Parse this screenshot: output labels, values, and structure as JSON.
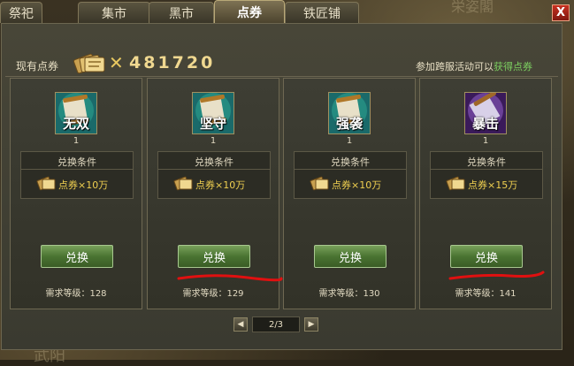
{
  "tabs": [
    {
      "label": "祭祀"
    },
    {
      "label": "集市"
    },
    {
      "label": "黑市"
    },
    {
      "label": "点券"
    },
    {
      "label": "铁匠铺"
    }
  ],
  "active_tab": "点券",
  "close_label": "X",
  "background_text": {
    "top_right": "栄姿閣",
    "bottom_left": "武阳"
  },
  "header": {
    "label": "现有点券",
    "multiplier": "✕",
    "points": "481720",
    "hint_prefix": "参加跨服活动可以",
    "hint_link": "获得点券"
  },
  "cards": [
    {
      "icon_text": "无双",
      "icon_style": "scroll-teal",
      "qty": "1",
      "cond_title": "兑换条件",
      "cond_value": "点券×10万",
      "button": "兑换",
      "requirement": "需求等级：128"
    },
    {
      "icon_text": "坚守",
      "icon_style": "scroll-teal",
      "qty": "1",
      "cond_title": "兑换条件",
      "cond_value": "点券×10万",
      "button": "兑换",
      "requirement": "需求等级：129"
    },
    {
      "icon_text": "强袭",
      "icon_style": "scroll-teal",
      "qty": "1",
      "cond_title": "兑换条件",
      "cond_value": "点券×10万",
      "button": "兑换",
      "requirement": "需求等级：130"
    },
    {
      "icon_text": "暴击",
      "icon_style": "scroll-purple",
      "qty": "1",
      "cond_title": "兑换条件",
      "cond_value": "点券×15万",
      "button": "兑换",
      "requirement": "需求等级：141"
    }
  ],
  "pager": {
    "prev": "◀",
    "page": "2/3",
    "next": "▶"
  },
  "colors": {
    "accent_green": "#7cd060",
    "points_gold": "#f0d890",
    "button_green": "#4a7432",
    "annotation_red": "#e01010"
  }
}
